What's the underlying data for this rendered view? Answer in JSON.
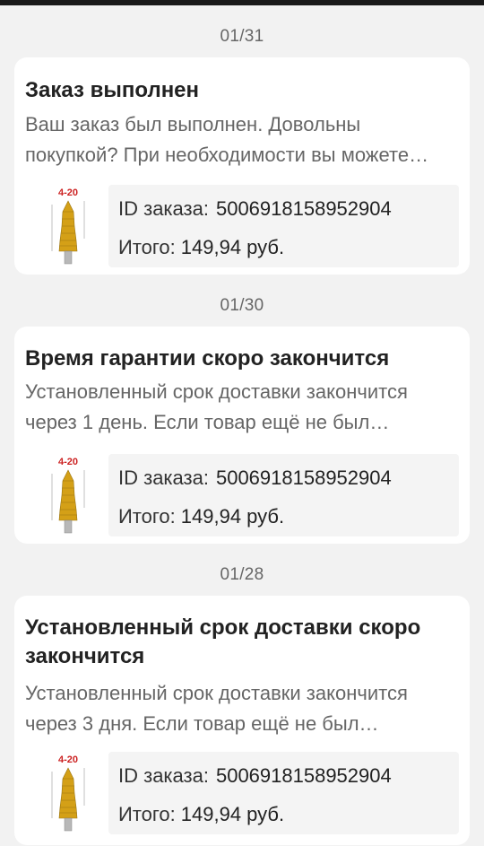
{
  "notifications": [
    {
      "date": "01/31",
      "title": "Заказ выполнен",
      "body": "Ваш заказ был выполнен. Довольны покупкой? При необходимости вы можете оставить отзыв.",
      "product_label": "4-20",
      "order_id_label": "ID заказа:",
      "order_id": "5006918158952904",
      "total_label": "Итого:",
      "total": "149,94 руб."
    },
    {
      "date": "01/30",
      "title": "Время гарантии скоро закончится",
      "body": "Установленный срок доставки закончится через 1 день. Если товар ещё не был доставлен, вы можете открыть спор.",
      "product_label": "4-20",
      "order_id_label": "ID заказа:",
      "order_id": "5006918158952904",
      "total_label": "Итого:",
      "total": "149,94 руб."
    },
    {
      "date": "01/28",
      "title": "Установленный срок доставки скоро закончится",
      "body": "Установленный срок доставки закончится через 3 дня. Если товар ещё не был доставлен, вы можете открыть спор.",
      "product_label": "4-20",
      "order_id_label": "ID заказа:",
      "order_id": "5006918158952904",
      "total_label": "Итого:",
      "total": "149,94 руб."
    }
  ],
  "colors": {
    "background": "#f2f2f2",
    "card": "#ffffff",
    "title": "#222222",
    "body": "#666666",
    "order_box": "#f4f4f4",
    "product_label": "#cc2222",
    "drill_gold": "#d4a017"
  }
}
